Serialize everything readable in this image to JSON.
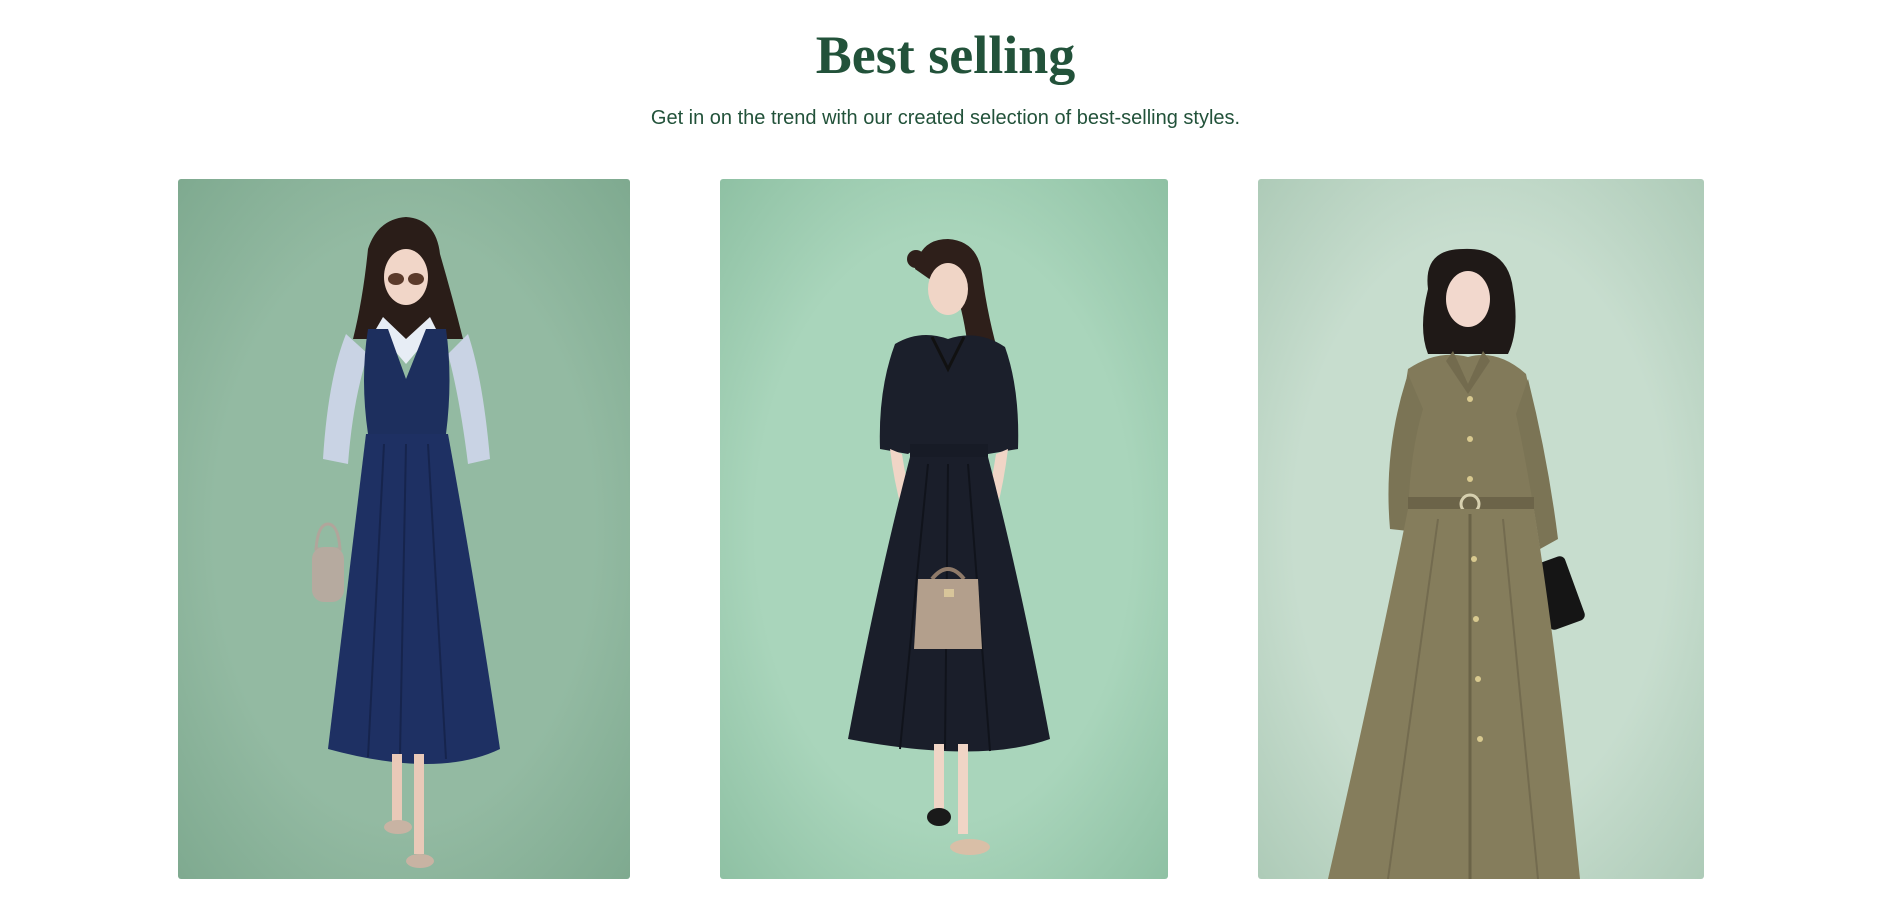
{
  "header": {
    "title": "Best selling",
    "subtitle": "Get in on the trend with our created selection of best-selling styles."
  },
  "colors": {
    "heading": "#22523a",
    "card_1_bg": "#92b9a1",
    "card_2_bg": "#a8d4ba",
    "card_3_bg": "#c6dccd"
  },
  "products": [
    {
      "image": "woman-navy-pinafore-dress-with-striped-shirt"
    },
    {
      "image": "woman-black-shirt-dress-with-handbag"
    },
    {
      "image": "woman-olive-belted-shirt-dress"
    }
  ]
}
